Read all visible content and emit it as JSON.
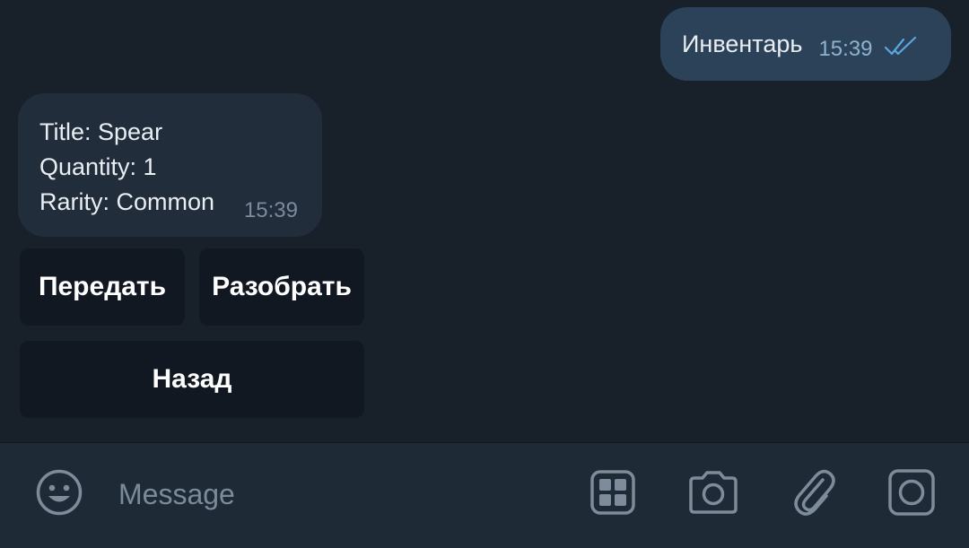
{
  "messages": {
    "outgoing": {
      "text": "Инвентарь",
      "time": "15:39",
      "status_icon": "double-check-icon"
    },
    "incoming": {
      "lines": [
        "Title: Spear",
        "Quantity: 1",
        "Rarity: Common"
      ],
      "time": "15:39"
    }
  },
  "keyboard": {
    "buttons": [
      {
        "label": "Передать"
      },
      {
        "label": "Разобрать"
      },
      {
        "label": "Назад"
      }
    ]
  },
  "composer": {
    "placeholder": "Message",
    "icons": [
      "emoji-icon",
      "bot-commands-icon",
      "camera-icon",
      "paperclip-icon",
      "video-message-icon"
    ]
  },
  "colors": {
    "background": "#18202a",
    "outgoing_bubble": "#2b4259",
    "incoming_bubble": "#212d3b",
    "keyboard_button": "#111821",
    "composer": "#1f2a37",
    "check_color": "#5aa7e0"
  }
}
